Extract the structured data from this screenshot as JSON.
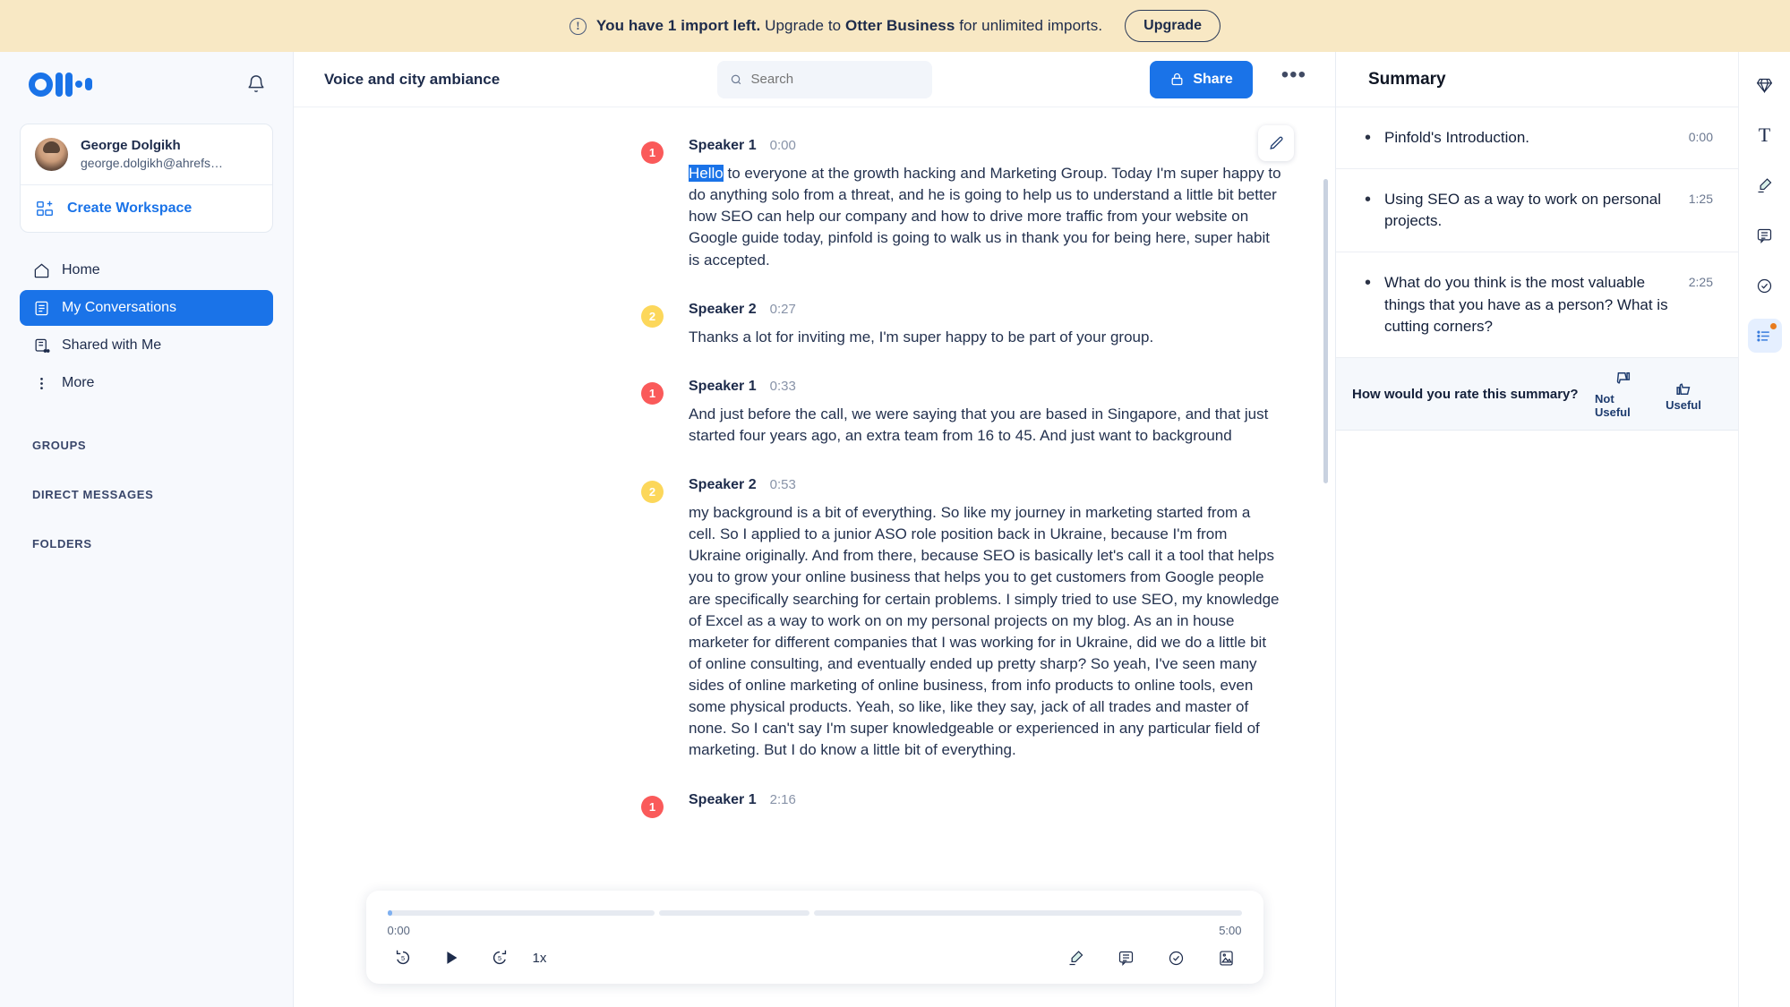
{
  "banner": {
    "icon": "alert-circle-icon",
    "text_bold": "You have 1 import left.",
    "text_mid": " Upgrade to ",
    "text_brand": "Otter Business",
    "text_end": " for unlimited imports.",
    "upgrade_label": "Upgrade"
  },
  "sidebar": {
    "logo_name": "otter-logo",
    "bell_name": "notification-bell-icon",
    "user": {
      "name": "George Dolgikh",
      "email": "george.dolgikh@ahrefs…"
    },
    "create_workspace_label": "Create Workspace",
    "nav": [
      {
        "label": "Home",
        "icon": "home-icon",
        "active": false
      },
      {
        "label": "My Conversations",
        "icon": "conversations-icon",
        "active": true
      },
      {
        "label": "Shared with Me",
        "icon": "shared-icon",
        "active": false
      },
      {
        "label": "More",
        "icon": "more-vertical-icon",
        "active": false
      }
    ],
    "sections": [
      "GROUPS",
      "DIRECT MESSAGES",
      "FOLDERS"
    ]
  },
  "topbar": {
    "title": "Voice and city ambiance",
    "search_placeholder": "Search",
    "search_value": "",
    "share_label": "Share",
    "more_label": "•••"
  },
  "transcript": {
    "edit_icon": "pencil-edit-icon",
    "segments": [
      {
        "speaker": "Speaker 1",
        "speaker_num": "1",
        "color": "#fa5a5a",
        "time": "0:00",
        "highlight": "Hello",
        "text": " to everyone at the growth hacking and Marketing Group. Today I'm super happy to do anything solo from a threat, and he is going to help us to understand a little bit better how SEO can help our company and how to drive more traffic from your website on Google guide today, pinfold is going to walk us in thank you for being here, super habit is accepted."
      },
      {
        "speaker": "Speaker 2",
        "speaker_num": "2",
        "color": "#fcd75b",
        "time": "0:27",
        "highlight": "",
        "text": "Thanks a lot for inviting me, I'm super happy to be part of your group."
      },
      {
        "speaker": "Speaker 1",
        "speaker_num": "1",
        "color": "#fa5a5a",
        "time": "0:33",
        "highlight": "",
        "text": "And just before the call, we were saying that you are based in Singapore, and that just started four years ago, an extra team from 16 to 45. And just want to background"
      },
      {
        "speaker": "Speaker 2",
        "speaker_num": "2",
        "color": "#fcd75b",
        "time": "0:53",
        "highlight": "",
        "text": "my background is a bit of everything. So like my journey in marketing started from a cell. So I applied to a junior ASO role position back in Ukraine, because I'm from Ukraine originally. And from there, because SEO is basically let's call it a tool that helps you to grow your online business that helps you to get customers from Google people are specifically searching for certain problems. I simply tried to use SEO, my knowledge of Excel as a way to work on on my personal projects on my blog. As an in house marketer for different companies that I was working for in Ukraine, did we do a little bit of online consulting, and eventually ended up pretty sharp? So yeah, I've seen many sides of online marketing of online business, from info products to online tools, even some physical products. Yeah, so like, like they say, jack of all trades and master of none. So I can't say I'm super knowledgeable or experienced in any particular field of marketing. But I do know a little bit of everything."
      },
      {
        "speaker": "Speaker 1",
        "speaker_num": "1",
        "color": "#fa5a5a",
        "time": "2:16",
        "highlight": "",
        "text": ""
      }
    ]
  },
  "player": {
    "current_time": "0:00",
    "total_time": "5:00",
    "speed": "1x",
    "rewind_icon": "rewind-5-icon",
    "play_icon": "play-icon",
    "forward_icon": "forward-5-icon",
    "right_icons": [
      "highlighter-icon",
      "comment-icon",
      "action-item-icon",
      "image-icon"
    ]
  },
  "summary": {
    "header": "Summary",
    "items": [
      {
        "text": "Pinfold's Introduction.",
        "time": "0:00"
      },
      {
        "text": "Using SEO as a way to work on personal projects.",
        "time": "1:25"
      },
      {
        "text": "What do you think is the most valuable things that you have as a person? What is cutting corners?",
        "time": "2:25"
      }
    ],
    "rate_question": "How would you rate this summary?",
    "not_useful_label": "Not Useful",
    "useful_label": "Useful"
  },
  "rail": {
    "items": [
      {
        "name": "gem-icon",
        "active": false
      },
      {
        "name": "text-format-icon",
        "active": false
      },
      {
        "name": "highlighter-icon",
        "active": false
      },
      {
        "name": "comment-icon",
        "active": false
      },
      {
        "name": "action-item-icon",
        "active": false
      },
      {
        "name": "summary-list-icon",
        "active": true
      }
    ]
  },
  "colors": {
    "accent": "#1a73e8",
    "banner_bg": "#f8e8c4",
    "speaker1": "#fa5a5a",
    "speaker2": "#fcd75b"
  }
}
